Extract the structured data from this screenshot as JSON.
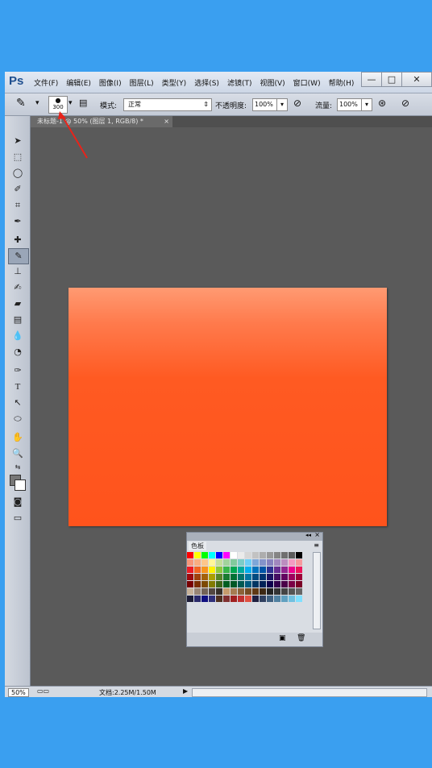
{
  "app": {
    "logo": "Ps"
  },
  "menu": [
    "文件(F)",
    "编辑(E)",
    "图像(I)",
    "图层(L)",
    "类型(Y)",
    "选择(S)",
    "滤镜(T)",
    "视图(V)",
    "窗口(W)",
    "帮助(H)"
  ],
  "window_buttons": {
    "min": "—",
    "max": "□",
    "close": "✕"
  },
  "options": {
    "brush_size": "300",
    "mode_label": "模式:",
    "mode_value": "正常",
    "opacity_label": "不透明度:",
    "opacity_value": "100%",
    "flow_label": "流量:",
    "flow_value": "100%"
  },
  "document_tab": {
    "title": "未标题-1 @ 50% (图层 1, RGB/8) *"
  },
  "swatches": {
    "title": "色板"
  },
  "status": {
    "zoom": "50%",
    "doc_info": "文档:2.25M/1.50M"
  },
  "colors": {
    "canvas_top": "#ff9a72",
    "canvas_bottom": "#ff531c",
    "annotation": "#e8231a"
  }
}
